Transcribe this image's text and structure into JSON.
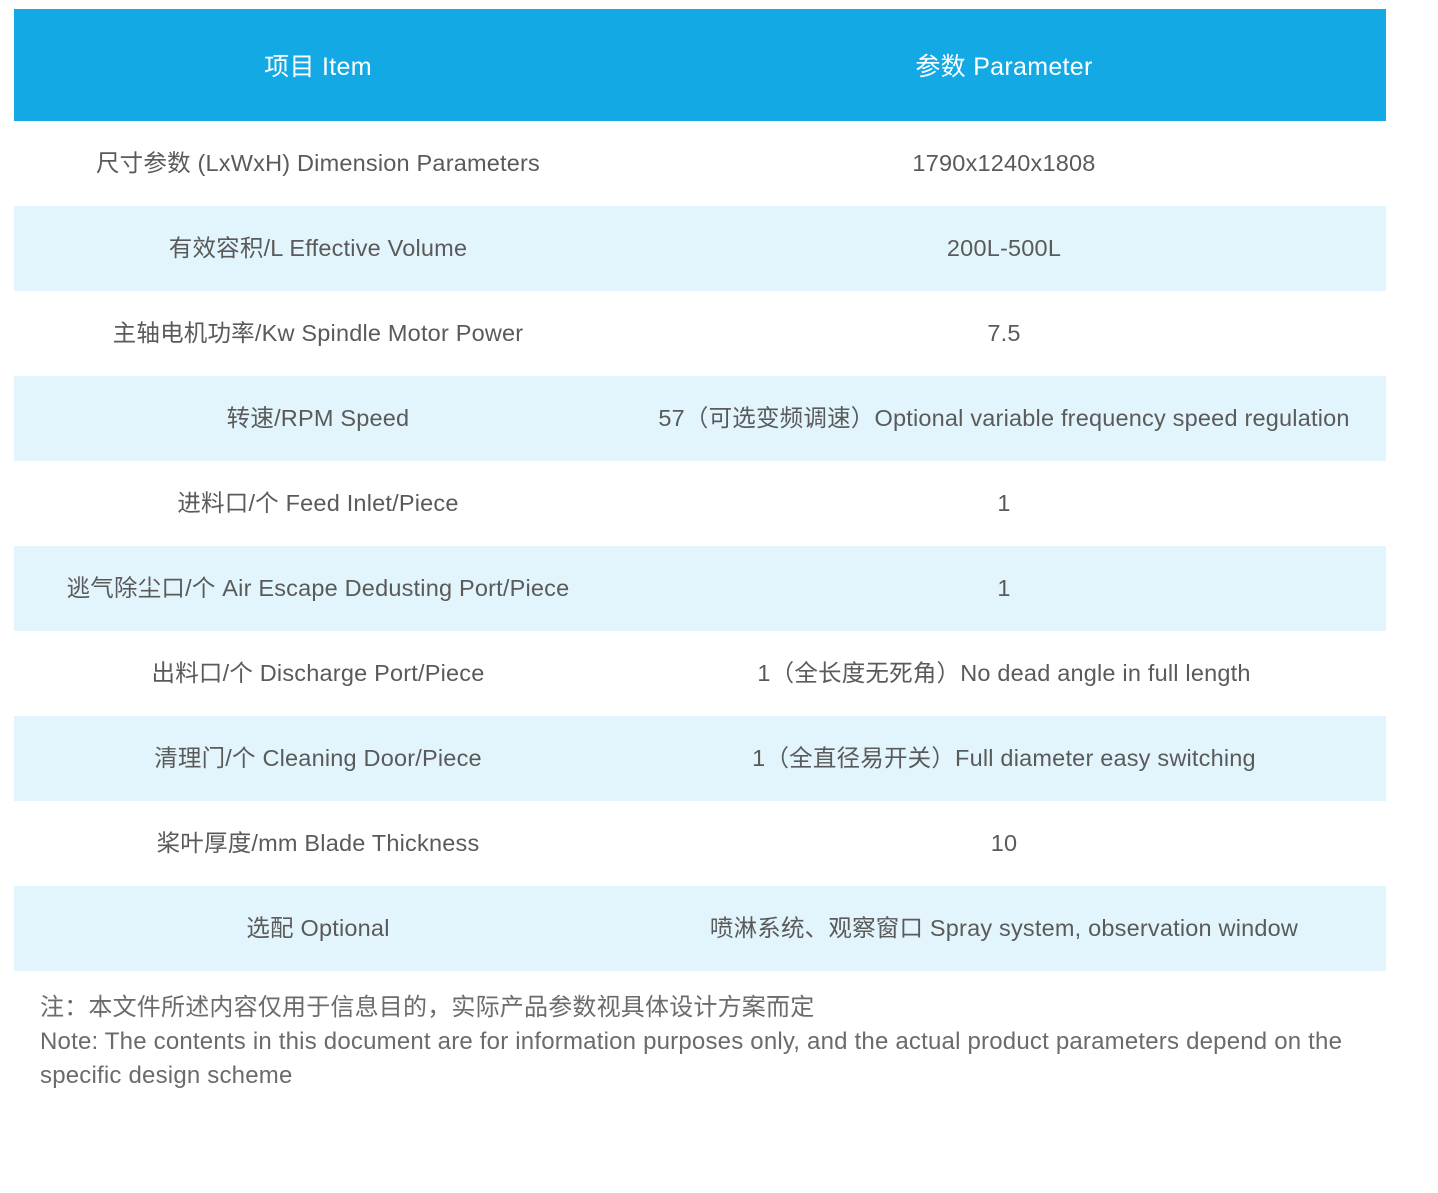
{
  "theme": {
    "header_background": "#13a9e5",
    "header_text_color": "#ffffff",
    "row_alt_background": "#e3f5fc",
    "row_background": "#ffffff",
    "body_text_color": "#5a5a5a",
    "note_text_color": "#6b6b6b"
  },
  "table": {
    "columns": [
      {
        "label": "项目 Item"
      },
      {
        "label": "参数 Parameter"
      }
    ],
    "rows": [
      {
        "item": "尺寸参数 (LxWxH) Dimension Parameters",
        "parameter": "1790x1240x1808"
      },
      {
        "item": "有效容积/L Effective Volume",
        "parameter": "200L-500L"
      },
      {
        "item": "主轴电机功率/Kw Spindle Motor Power",
        "parameter": "7.5"
      },
      {
        "item": "转速/RPM Speed",
        "parameter": "57（可选变频调速）Optional variable frequency speed regulation"
      },
      {
        "item": "进料口/个 Feed Inlet/Piece",
        "parameter": "1"
      },
      {
        "item": "逃气除尘口/个 Air Escape Dedusting Port/Piece",
        "parameter": "1"
      },
      {
        "item": "出料口/个 Discharge Port/Piece",
        "parameter": "1（全长度无死角）No dead angle in full length"
      },
      {
        "item": "清理门/个 Cleaning Door/Piece",
        "parameter": "1（全直径易开关）Full diameter easy switching"
      },
      {
        "item": "桨叶厚度/mm Blade Thickness",
        "parameter": "10"
      },
      {
        "item": "选配 Optional",
        "parameter": "喷淋系统、观察窗口 Spray system, observation window"
      }
    ]
  },
  "note": {
    "line_cn": "注：本文件所述内容仅用于信息目的，实际产品参数视具体设计方案而定",
    "line_en": "Note: The contents in this document are for information purposes only, and the actual product parameters depend on the specific design scheme"
  }
}
